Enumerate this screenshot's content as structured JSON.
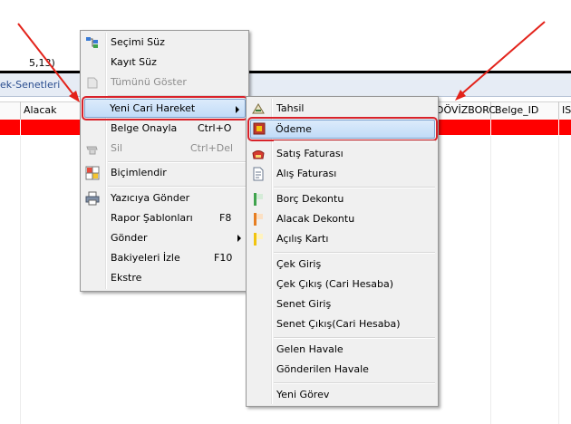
{
  "background": {
    "value_text": "5,13)",
    "tab_label": "ek-Senetleri",
    "columns": {
      "alacak": "Alacak",
      "dovizborc": "DÖVİZBORC",
      "belge_id": "Belge_ID",
      "is": "IS"
    }
  },
  "context_menu": {
    "items": [
      {
        "label": "Seçimi Süz",
        "icon": "filter-selection-icon"
      },
      {
        "label": "Kayıt Süz",
        "icon": "none"
      },
      {
        "label": "Tümünü Göster",
        "icon": "show-all-icon",
        "disabled": true
      },
      {
        "label": "Yeni Cari Hareket",
        "icon": "none",
        "has_submenu": true,
        "highlighted": true
      },
      {
        "label": "Belge Onayla",
        "shortcut": "Ctrl+O"
      },
      {
        "label": "Sil",
        "shortcut": "Ctrl+Del",
        "icon": "delete-icon",
        "disabled": true
      },
      {
        "label": "Biçimlendir",
        "icon": "format-icon"
      },
      {
        "label": "Yazıcıya Gönder",
        "icon": "printer-icon"
      },
      {
        "label": "Rapor Şablonları",
        "shortcut": "F8"
      },
      {
        "label": "Gönder",
        "has_submenu": true
      },
      {
        "label": "Bakiyeleri İzle",
        "shortcut": "F10"
      },
      {
        "label": "Ekstre"
      }
    ]
  },
  "submenu": {
    "items": [
      {
        "label": "Tahsil",
        "icon": "collect-icon"
      },
      {
        "label": "Ödeme",
        "icon": "payment-icon",
        "highlighted": true
      },
      {
        "label": "Satış Faturası",
        "icon": "sales-invoice-icon"
      },
      {
        "label": "Alış Faturası",
        "icon": "purchase-invoice-icon"
      },
      {
        "label": "Borç Dekontu",
        "icon": "debit-note-icon"
      },
      {
        "label": "Alacak Dekontu",
        "icon": "credit-note-icon"
      },
      {
        "label": "Açılış Kartı",
        "icon": "opening-card-icon"
      },
      {
        "label": "Çek Giriş"
      },
      {
        "label": "Çek Çıkış (Cari Hesaba)"
      },
      {
        "label": "Senet Giriş"
      },
      {
        "label": "Senet Çıkış(Cari Hesaba)"
      },
      {
        "label": "Gelen Havale"
      },
      {
        "label": "Gönderilen Havale"
      },
      {
        "label": "Yeni Görev"
      }
    ]
  },
  "colors": {
    "highlight_outline": "#d8222a",
    "row_red": "#ff0000",
    "arrow_red": "#e3231b"
  }
}
